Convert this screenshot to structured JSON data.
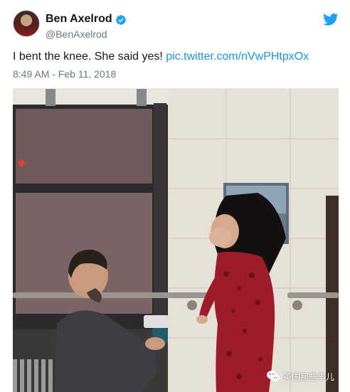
{
  "author": {
    "name": "Ben Axelrod",
    "handle": "@BenAxelrod"
  },
  "tweet": {
    "text": "I bent the knee. She said yes!",
    "link": "pic.twitter.com/nVwPHtpxOx",
    "timestamp": "8:49 AM - Feb 11, 2018"
  },
  "watermark": {
    "text": "英国那些事儿"
  },
  "colors": {
    "link": "#1b95e0",
    "verified": "#1da1f2",
    "secondary_text": "#657786"
  },
  "icons": {
    "verified": "verified-badge-icon",
    "brand": "twitter-bird-icon",
    "watermark": "wechat-icon"
  }
}
